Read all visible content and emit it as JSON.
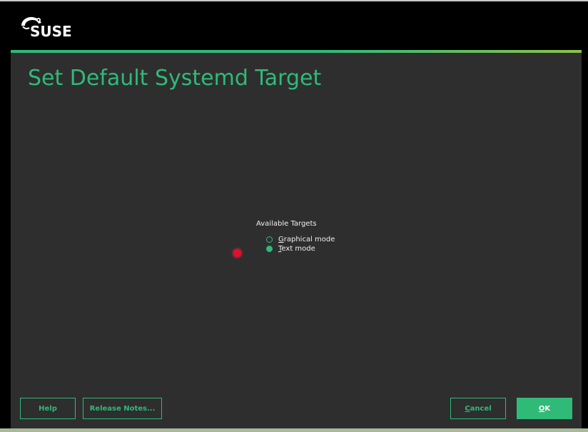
{
  "logo": {
    "text": "SUSE"
  },
  "page": {
    "title": "Set Default Systemd Target"
  },
  "targets": {
    "group_label": "Available Targets",
    "options": [
      {
        "label": "Graphical mode",
        "mnemonic": "G",
        "rest": "raphical mode",
        "selected": false
      },
      {
        "label": "Text mode",
        "mnemonic": "T",
        "rest": "ext mode",
        "selected": true
      }
    ]
  },
  "buttons": {
    "help": "Help",
    "release_notes": "Release Notes...",
    "cancel": "Cancel",
    "cancel_mnemonic": "C",
    "cancel_rest": "ancel",
    "ok": "OK",
    "ok_mnemonic": "O",
    "ok_rest": "K"
  },
  "colors": {
    "accent": "#30ba78",
    "background": "#2e2e2e",
    "frame": "#000000",
    "cursor": "#e0102a"
  },
  "icons": {
    "logo": "suse-chameleon-icon",
    "cursor": "pointer-dot-icon"
  }
}
